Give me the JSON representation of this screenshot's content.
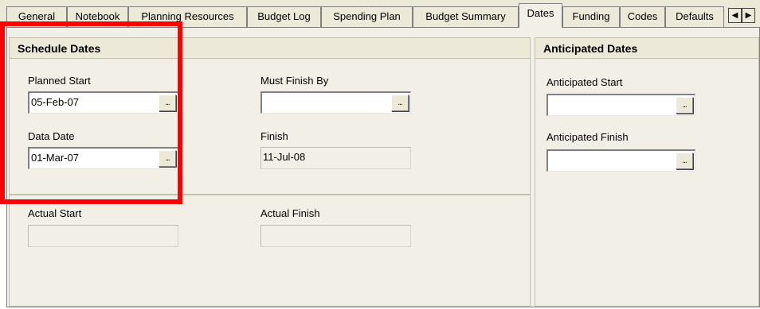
{
  "tabs": [
    {
      "label": "General"
    },
    {
      "label": "Notebook"
    },
    {
      "label": "Planning Resources"
    },
    {
      "label": "Budget Log"
    },
    {
      "label": "Spending Plan"
    },
    {
      "label": "Budget Summary"
    },
    {
      "label": "Dates"
    },
    {
      "label": "Funding"
    },
    {
      "label": "Codes"
    },
    {
      "label": "Defaults"
    }
  ],
  "active_tab": "Dates",
  "tab_scroll": {
    "left": "◀",
    "right": "▶"
  },
  "schedule_dates": {
    "title": "Schedule Dates",
    "planned_start": {
      "label": "Planned Start",
      "value": "05-Feb-07"
    },
    "must_finish_by": {
      "label": "Must Finish By",
      "value": ""
    },
    "data_date": {
      "label": "Data Date",
      "value": "01-Mar-07"
    },
    "finish": {
      "label": "Finish",
      "value": "11-Jul-08"
    }
  },
  "actual_dates": {
    "actual_start": {
      "label": "Actual Start",
      "value": ""
    },
    "actual_finish": {
      "label": "Actual Finish",
      "value": ""
    }
  },
  "anticipated_dates": {
    "title": "Anticipated Dates",
    "anticipated_start": {
      "label": "Anticipated Start",
      "value": ""
    },
    "anticipated_finish": {
      "label": "Anticipated Finish",
      "value": ""
    }
  },
  "ellipsis_label": "...",
  "highlight_color": "#ff0000"
}
